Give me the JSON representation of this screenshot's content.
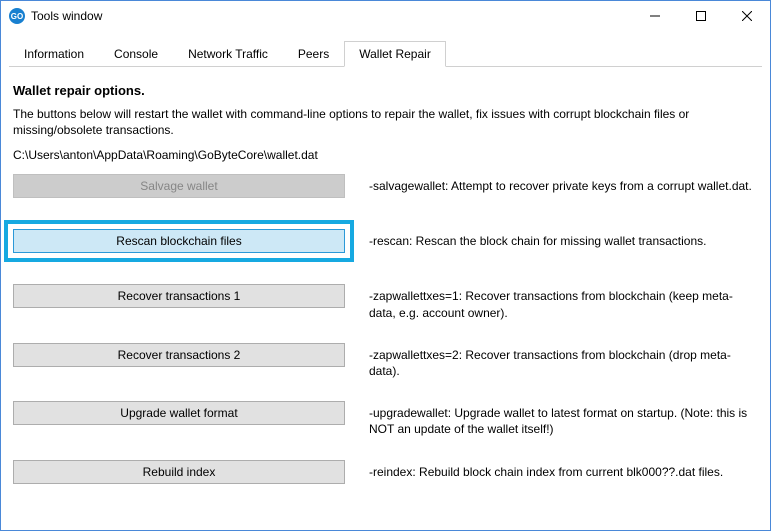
{
  "window": {
    "title": "Tools window"
  },
  "tabs": [
    {
      "label": "Information"
    },
    {
      "label": "Console"
    },
    {
      "label": "Network Traffic"
    },
    {
      "label": "Peers"
    },
    {
      "label": "Wallet Repair"
    }
  ],
  "page": {
    "heading": "Wallet repair options.",
    "intro": "The buttons below will restart the wallet with command-line options to repair the wallet, fix issues with corrupt blockchain files or missing/obsolete transactions.",
    "path": "C:\\Users\\anton\\AppData\\Roaming\\GoByteCore\\wallet.dat"
  },
  "options": [
    {
      "button": "Salvage wallet",
      "desc": "-salvagewallet: Attempt to recover private keys from a corrupt wallet.dat."
    },
    {
      "button": "Rescan blockchain files",
      "desc": "-rescan: Rescan the block chain for missing wallet transactions."
    },
    {
      "button": "Recover transactions 1",
      "desc": "-zapwallettxes=1: Recover transactions from blockchain (keep meta-data, e.g. account owner)."
    },
    {
      "button": "Recover transactions 2",
      "desc": "-zapwallettxes=2: Recover transactions from blockchain (drop meta-data)."
    },
    {
      "button": "Upgrade wallet format",
      "desc": "-upgradewallet: Upgrade wallet to latest format on startup. (Note: this is NOT an update of the wallet itself!)"
    },
    {
      "button": "Rebuild index",
      "desc": "-reindex: Rebuild block chain index from current blk000??.dat files."
    }
  ]
}
